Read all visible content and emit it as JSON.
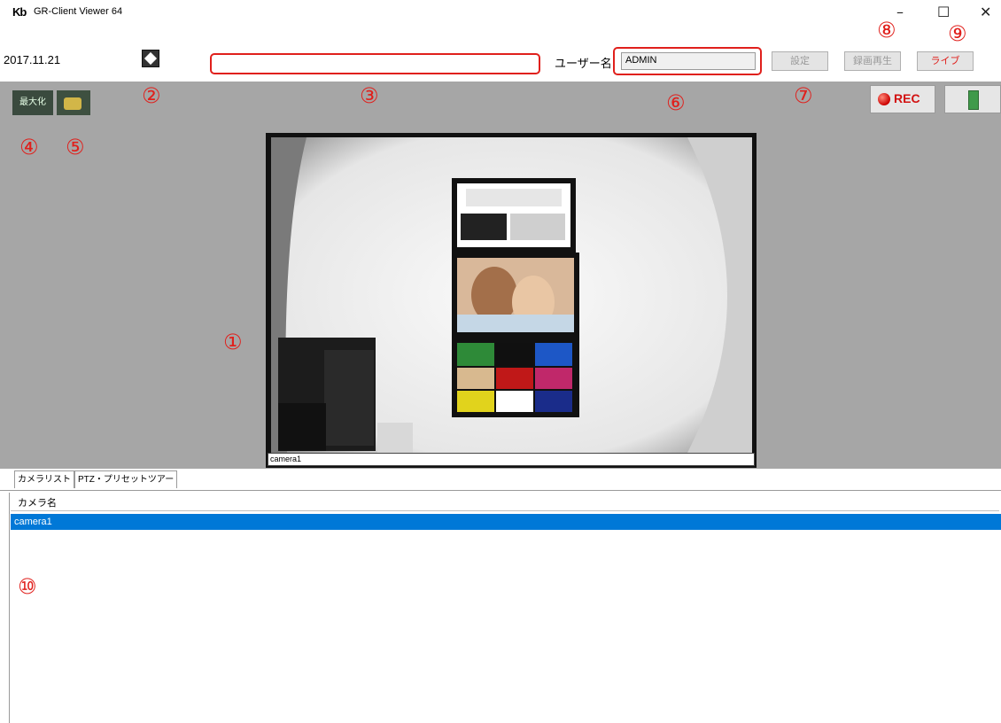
{
  "window": {
    "logo_text": "Kb",
    "title": "GR-Client Viewer 64",
    "minimize_glyph": "–",
    "maximize_glyph": "☐",
    "close_glyph": "✕"
  },
  "toolbar": {
    "date": "2017.11.21",
    "user_label": "ユーザー名",
    "user_value": "ADMIN",
    "settings_label": "設定",
    "playback_label": "録画再生",
    "live_label": "ライブ"
  },
  "controls": {
    "maximize_label": "最大化",
    "rec_label": "REC"
  },
  "camera_view": {
    "caption": "camera1"
  },
  "tabs": [
    {
      "label": "カメラリスト"
    },
    {
      "label": "PTZ・プリセットツアー"
    }
  ],
  "camera_list": {
    "column_header": "カメラ名",
    "rows": [
      {
        "name": "camera1",
        "selected": true
      }
    ]
  },
  "annotations": [
    "①",
    "②",
    "③",
    "④",
    "⑤",
    "⑥",
    "⑦",
    "⑧",
    "⑨",
    "⑩"
  ],
  "colors": {
    "annotation": "#e0201c",
    "selection": "#0078d7",
    "work_area": "#a6a6a6"
  }
}
